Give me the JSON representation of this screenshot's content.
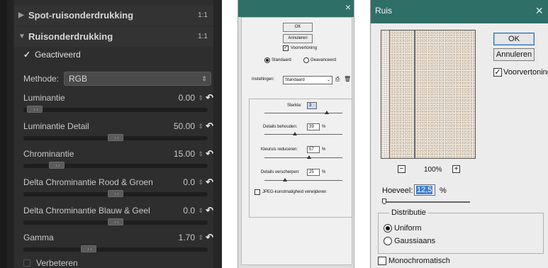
{
  "left_panel": {
    "section1": {
      "title": "Spot-ruisonderdrukking",
      "mark": "1:1"
    },
    "section2": {
      "title": "Ruisonderdrukking",
      "mark": "1:1"
    },
    "enabled": {
      "label": "Geactiveerd",
      "check": "✓"
    },
    "method": {
      "label": "Methode:",
      "value": "RGB"
    },
    "sliders": [
      {
        "label": "Luminantie",
        "value": "0.00",
        "level": 0.02
      },
      {
        "label": "Luminantie Detail",
        "value": "50.00",
        "level": 0.5
      },
      {
        "label": "Chrominantie",
        "value": "15.00",
        "level": 0.15
      },
      {
        "label": "Delta Chrominantie Rood & Groen",
        "value": "0.0",
        "level": 0.5
      },
      {
        "label": "Delta Chrominantie Blauw & Geel",
        "value": "0.0",
        "level": 0.5
      },
      {
        "label": "Gamma",
        "value": "1.70",
        "level": 0.34
      }
    ],
    "enhance": {
      "label": "Verbeteren"
    }
  },
  "middle_dialog": {
    "ok": "OK",
    "cancel": "Annuleren",
    "preview": "Voorvertoning",
    "mode_standard": "Standaard",
    "mode_advanced": "Geavanceerd",
    "settings_label": "Instellingen:",
    "settings_value": "Standaard",
    "strength": {
      "label": "Sterkte:",
      "value": "3",
      "unit": ""
    },
    "preserve_details": {
      "label": "Details behouden:",
      "value": "39",
      "unit": "%"
    },
    "reduce_color_noise": {
      "label": "Kleuruis reduceren:",
      "value": "57",
      "unit": "%"
    },
    "sharpen_details": {
      "label": "Details verscherpen:",
      "value": "25",
      "unit": "%"
    },
    "remove_jpeg": "JPEG-kunstmatigheid verwijderen"
  },
  "right_dialog": {
    "title": "Ruis",
    "ok": "OK",
    "cancel": "Annuleren",
    "preview": "Voorvertoning",
    "zoom": "100%",
    "amount": {
      "label": "Hoeveel:",
      "value": "12,5",
      "unit": "%"
    },
    "distribution": {
      "label": "Distributie",
      "uniform": "Uniform",
      "gaussian": "Gaussiaans"
    },
    "monochromatic": "Monochromatisch"
  }
}
